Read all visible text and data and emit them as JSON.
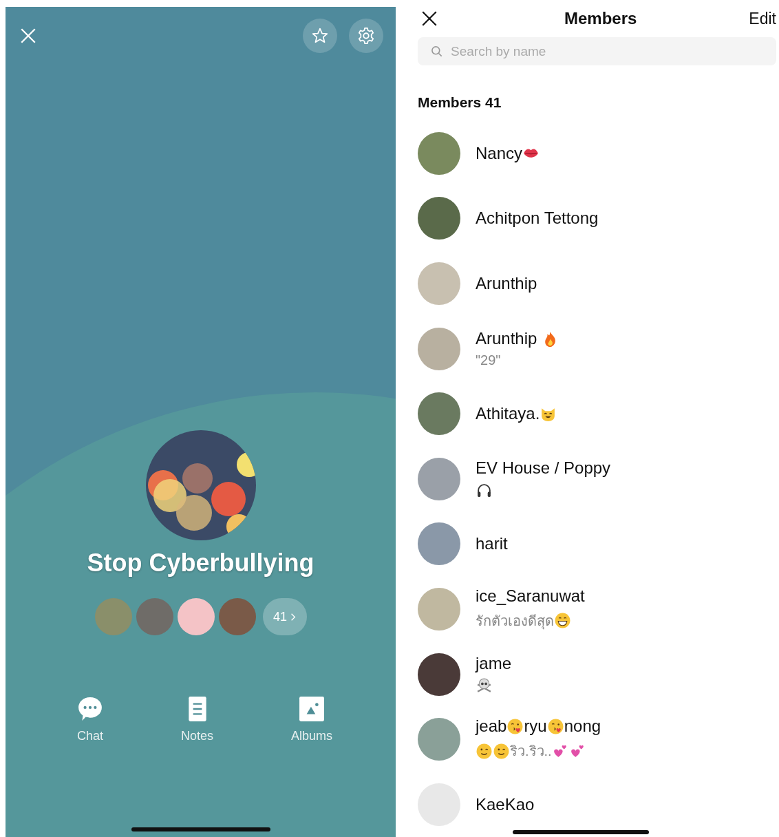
{
  "group_screen": {
    "title": "Stop Cyberbullying",
    "member_avatars": [
      {
        "color": "#8a8f6a"
      },
      {
        "color": "#6f6c68"
      },
      {
        "color": "#f4c3c6"
      },
      {
        "color": "#7a5a48"
      }
    ],
    "member_count": "41",
    "actions": [
      {
        "kind": "chat",
        "label": "Chat"
      },
      {
        "kind": "notes",
        "label": "Notes"
      },
      {
        "kind": "albums",
        "label": "Albums"
      }
    ]
  },
  "members_screen": {
    "title": "Members",
    "edit": "Edit",
    "search": {
      "placeholder": "Search by name"
    },
    "heading": "Members 41",
    "members": [
      {
        "name": [
          {
            "kind": "text",
            "text": "Nancy"
          },
          {
            "kind": "lips"
          }
        ]
      },
      {
        "name": [
          {
            "kind": "text",
            "text": "Achitpon Tettong"
          }
        ]
      },
      {
        "name": [
          {
            "kind": "text",
            "text": "Arunthip"
          }
        ]
      },
      {
        "name": [
          {
            "kind": "text",
            "text": "Arunthip "
          },
          {
            "kind": "fire"
          }
        ],
        "status": [
          {
            "kind": "text",
            "text": "\"29\""
          }
        ]
      },
      {
        "name": [
          {
            "kind": "text",
            "text": "Athitaya."
          },
          {
            "kind": "cat"
          }
        ]
      },
      {
        "name": [
          {
            "kind": "text",
            "text": "EV House / Poppy"
          }
        ],
        "status": [
          {
            "kind": "headphones"
          }
        ]
      },
      {
        "name": [
          {
            "kind": "text",
            "text": "harit"
          }
        ]
      },
      {
        "name": [
          {
            "kind": "text",
            "text": "ice_Saranuwat"
          }
        ],
        "status": [
          {
            "kind": "text",
            "text": "รักตัวเองดีสุด"
          },
          {
            "kind": "grin"
          }
        ]
      },
      {
        "name": [
          {
            "kind": "text",
            "text": "jame"
          }
        ],
        "status": [
          {
            "kind": "skull"
          }
        ]
      },
      {
        "name": [
          {
            "kind": "text",
            "text": "jeab"
          },
          {
            "kind": "kiss"
          },
          {
            "kind": "text",
            "text": "ryu"
          },
          {
            "kind": "kiss"
          },
          {
            "kind": "text",
            "text": "nong"
          }
        ],
        "status": [
          {
            "kind": "wink"
          },
          {
            "kind": "wink"
          },
          {
            "kind": "text",
            "text": "ริว.ริว.."
          },
          {
            "kind": "hearts"
          },
          {
            "kind": "hearts"
          }
        ]
      },
      {
        "name": [
          {
            "kind": "text",
            "text": "KaeKao"
          }
        ]
      }
    ]
  }
}
